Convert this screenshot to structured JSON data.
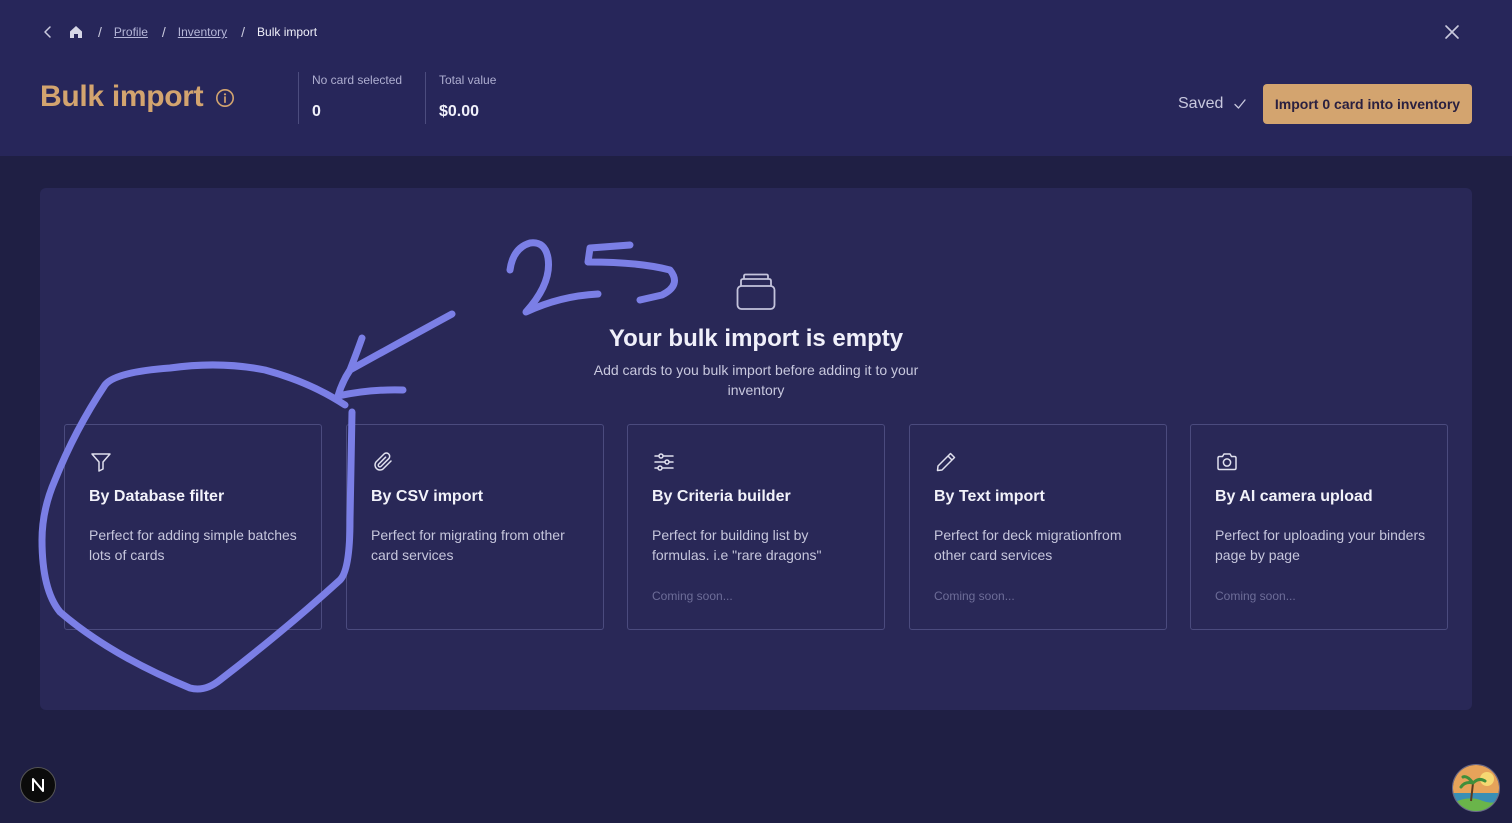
{
  "breadcrumb": {
    "items": [
      {
        "label": "Profile"
      },
      {
        "label": "Inventory"
      },
      {
        "label": "Bulk import"
      }
    ],
    "separator": "/"
  },
  "header": {
    "title": "Bulk import",
    "stats": [
      {
        "label": "No card selected",
        "value": "0"
      },
      {
        "label": "Total value",
        "value": "$0.00"
      }
    ],
    "saved_label": "Saved",
    "import_button_label": "Import 0 card into inventory"
  },
  "empty_state": {
    "title": "Your bulk import is empty",
    "subtitle": "Add cards to you bulk import before adding it to your inventory"
  },
  "import_options": [
    {
      "icon": "filter-icon",
      "title": "By Database filter",
      "description": "Perfect for adding simple batches lots of cards",
      "status": ""
    },
    {
      "icon": "paperclip-icon",
      "title": "By CSV import",
      "description": "Perfect for migrating from other card services",
      "status": ""
    },
    {
      "icon": "sliders-icon",
      "title": "By Criteria builder",
      "description": "Perfect for building list by formulas. i.e \"rare dragons\"",
      "status": "Coming soon..."
    },
    {
      "icon": "pencil-icon",
      "title": "By Text import",
      "description": "Perfect for deck migrationfrom other card services",
      "status": "Coming soon..."
    },
    {
      "icon": "camera-icon",
      "title": "By AI camera upload",
      "description": "Perfect for uploading your binders page by page",
      "status": "Coming soon..."
    }
  ],
  "annotation": {
    "text": "25"
  },
  "colors": {
    "accent": "#d3a46f",
    "background": "#1f1f44",
    "header": "#27265a",
    "panel": "#292857",
    "annotation": "#7b7fe6"
  }
}
